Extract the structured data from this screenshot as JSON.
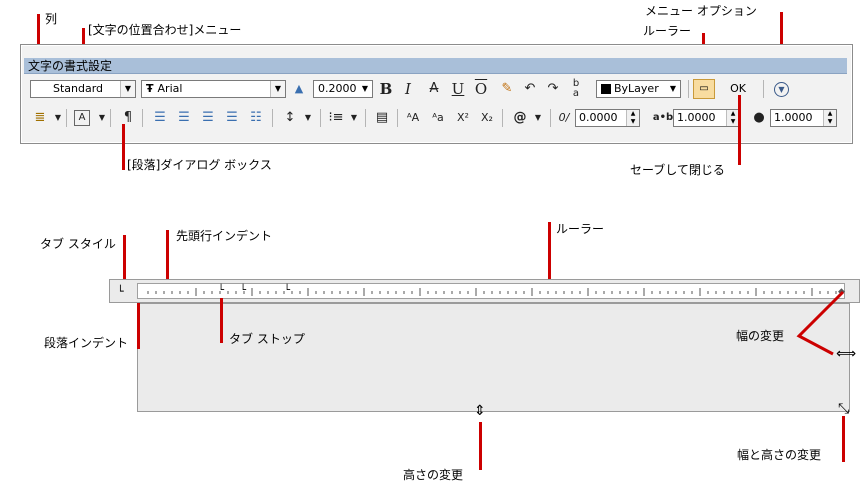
{
  "callouts": {
    "column": "列",
    "justify_menu": "[文字の位置合わせ]メニュー",
    "menu_options": "メニュー オプション",
    "ruler_top": "ルーラー",
    "paragraph_dialog": "[段落]ダイアログ ボックス",
    "save_close": "セーブして閉じる",
    "tab_style": "タブ スタイル",
    "first_indent": "先頭行インデント",
    "ruler_mid": "ルーラー",
    "paragraph_indent": "段落インデント",
    "tab_stop": "タブ ストップ",
    "width_change": "幅の変更",
    "height_change": "高さの変更",
    "width_height_change": "幅と高さの変更"
  },
  "toolbar": {
    "title": "文字の書式設定",
    "style_value": "Standard",
    "font_value": "Arial",
    "font_prefix": "Ŧ",
    "height_value": "0.2000",
    "bold": "B",
    "italic": "I",
    "strike": "A",
    "underline": "U",
    "overline": "O",
    "color_value": "ByLayer",
    "ok_label": "OK",
    "oblique_value": "0.0000",
    "tracking_value": "1.0000",
    "width_factor_value": "1.0000",
    "oblique_prefix": "0/",
    "tracking_prefix": "a•b",
    "superscript": "X²",
    "subscript": "X₂",
    "at_symbol": "@",
    "caps_upper": "ᴬA",
    "caps_lower": "ᴬa"
  },
  "icons": [
    "columns-icon",
    "justify-icon",
    "paragraph-icon",
    "align-left-icon",
    "align-center-icon",
    "align-right-icon",
    "justify-all-icon",
    "distribute-icon",
    "line-spacing-icon",
    "numbering-icon",
    "insert-field-icon",
    "uppercase-icon",
    "lowercase-icon",
    "superscript-icon",
    "subscript-icon",
    "symbol-icon",
    "oblique-icon",
    "tracking-icon",
    "width-factor-icon",
    "ruler-icon",
    "options-icon",
    "undo-icon",
    "redo-icon",
    "stack-icon",
    "match-icon",
    "annotative-icon"
  ],
  "colors": {
    "accent_red": "#cc0000",
    "titlebar": "#a9bfd9"
  }
}
